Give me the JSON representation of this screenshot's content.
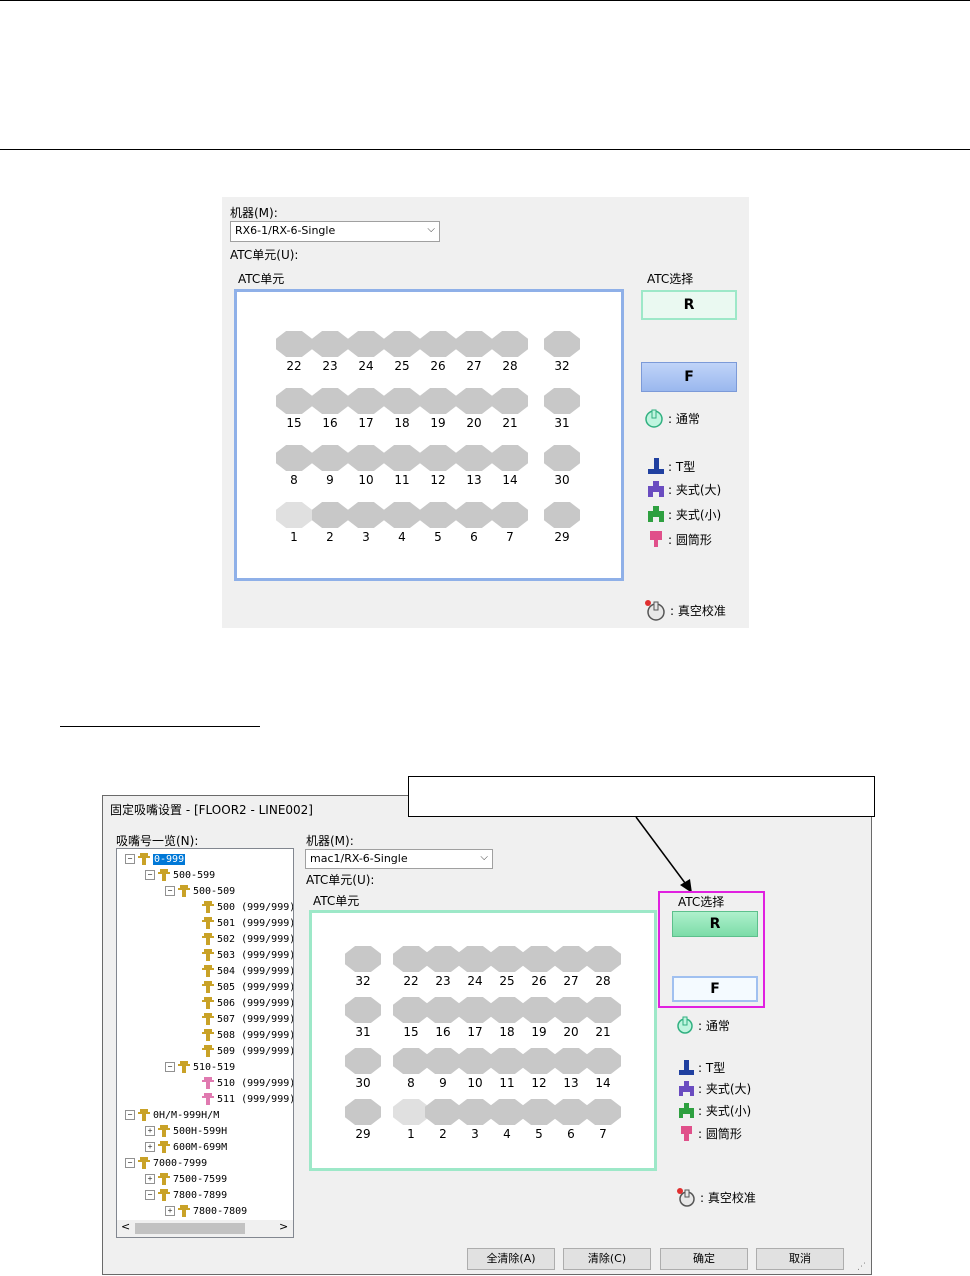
{
  "top": {
    "machine_label": "机器(M):",
    "machine_value": "RX6-1/RX-6-Single",
    "atc_unit_label": "ATC单元(U):",
    "atc_unit_group": "ATC单元",
    "atc_select_label": "ATC选择",
    "btn_r": "R",
    "btn_f": "F",
    "rows": [
      [
        "22",
        "23",
        "24",
        "25",
        "26",
        "27",
        "28",
        "32"
      ],
      [
        "15",
        "16",
        "17",
        "18",
        "19",
        "20",
        "21",
        "31"
      ],
      [
        "8",
        "9",
        "10",
        "11",
        "12",
        "13",
        "14",
        "30"
      ],
      [
        "1",
        "2",
        "3",
        "4",
        "5",
        "6",
        "7",
        "29"
      ]
    ]
  },
  "legend": {
    "normal": ": 通常",
    "t_type": ": T型",
    "clamp_large": ": 夹式(大)",
    "clamp_small": ": 夹式(小)",
    "cylinder": ": 圆筒形",
    "vacuum": ": 真空校准"
  },
  "dialog": {
    "title": "固定吸嘴设置 - [FLOOR2 - LINE002]",
    "list_label": "吸嘴号一览(N):",
    "machine_label": "机器(M):",
    "machine_value": "mac1/RX-6-Single",
    "atc_unit_label": "ATC单元(U):",
    "atc_unit_group": "ATC单元",
    "atc_select_label": "ATC选择",
    "btn_r": "R",
    "btn_f": "F",
    "rows": [
      [
        "32",
        "22",
        "23",
        "24",
        "25",
        "26",
        "27",
        "28"
      ],
      [
        "31",
        "15",
        "16",
        "17",
        "18",
        "19",
        "20",
        "21"
      ],
      [
        "30",
        "8",
        "9",
        "10",
        "11",
        "12",
        "13",
        "14"
      ],
      [
        "29",
        "1",
        "2",
        "3",
        "4",
        "5",
        "6",
        "7"
      ]
    ],
    "tree": [
      {
        "text": "0-999",
        "pm": "⊟",
        "selected": true
      },
      {
        "text": "500-599",
        "pm": "⊟"
      },
      {
        "text": "500-509",
        "pm": "⊟"
      },
      {
        "text": "500 (999/999)",
        "pm": ""
      },
      {
        "text": "501 (999/999)",
        "pm": ""
      },
      {
        "text": "502 (999/999)",
        "pm": ""
      },
      {
        "text": "503 (999/999)",
        "pm": ""
      },
      {
        "text": "504 (999/999)",
        "pm": ""
      },
      {
        "text": "505 (999/999)",
        "pm": ""
      },
      {
        "text": "506 (999/999)",
        "pm": ""
      },
      {
        "text": "507 (999/999)",
        "pm": ""
      },
      {
        "text": "508 (999/999)",
        "pm": ""
      },
      {
        "text": "509 (999/999)",
        "pm": ""
      },
      {
        "text": "510-519",
        "pm": "⊟"
      },
      {
        "text": "510 (999/999)",
        "pm": ""
      },
      {
        "text": "511 (999/999)",
        "pm": ""
      },
      {
        "text": "0H/M-999H/M",
        "pm": "⊟"
      },
      {
        "text": "500H-599H",
        "pm": "⊞"
      },
      {
        "text": "600M-699M",
        "pm": "⊞"
      },
      {
        "text": "7000-7999",
        "pm": "⊟"
      },
      {
        "text": "7500-7599",
        "pm": "⊞"
      },
      {
        "text": "7800-7899",
        "pm": "⊟"
      },
      {
        "text": "7800-7809",
        "pm": "⊞"
      }
    ],
    "buttons": {
      "clear_all": "全清除(A)",
      "clear": "清除(C)",
      "ok": "确定",
      "cancel": "取消"
    }
  },
  "colors": {
    "top_frame": "#8fb0e8",
    "dialog_frame": "#9de8c8",
    "callout_magenta": "#e020e0",
    "btn_r_top": "#e8f8f0",
    "btn_f_top": "#a8c0f0",
    "btn_r_dialog": "#8ee0b0",
    "btn_f_dialog": "#f0f8ff"
  }
}
